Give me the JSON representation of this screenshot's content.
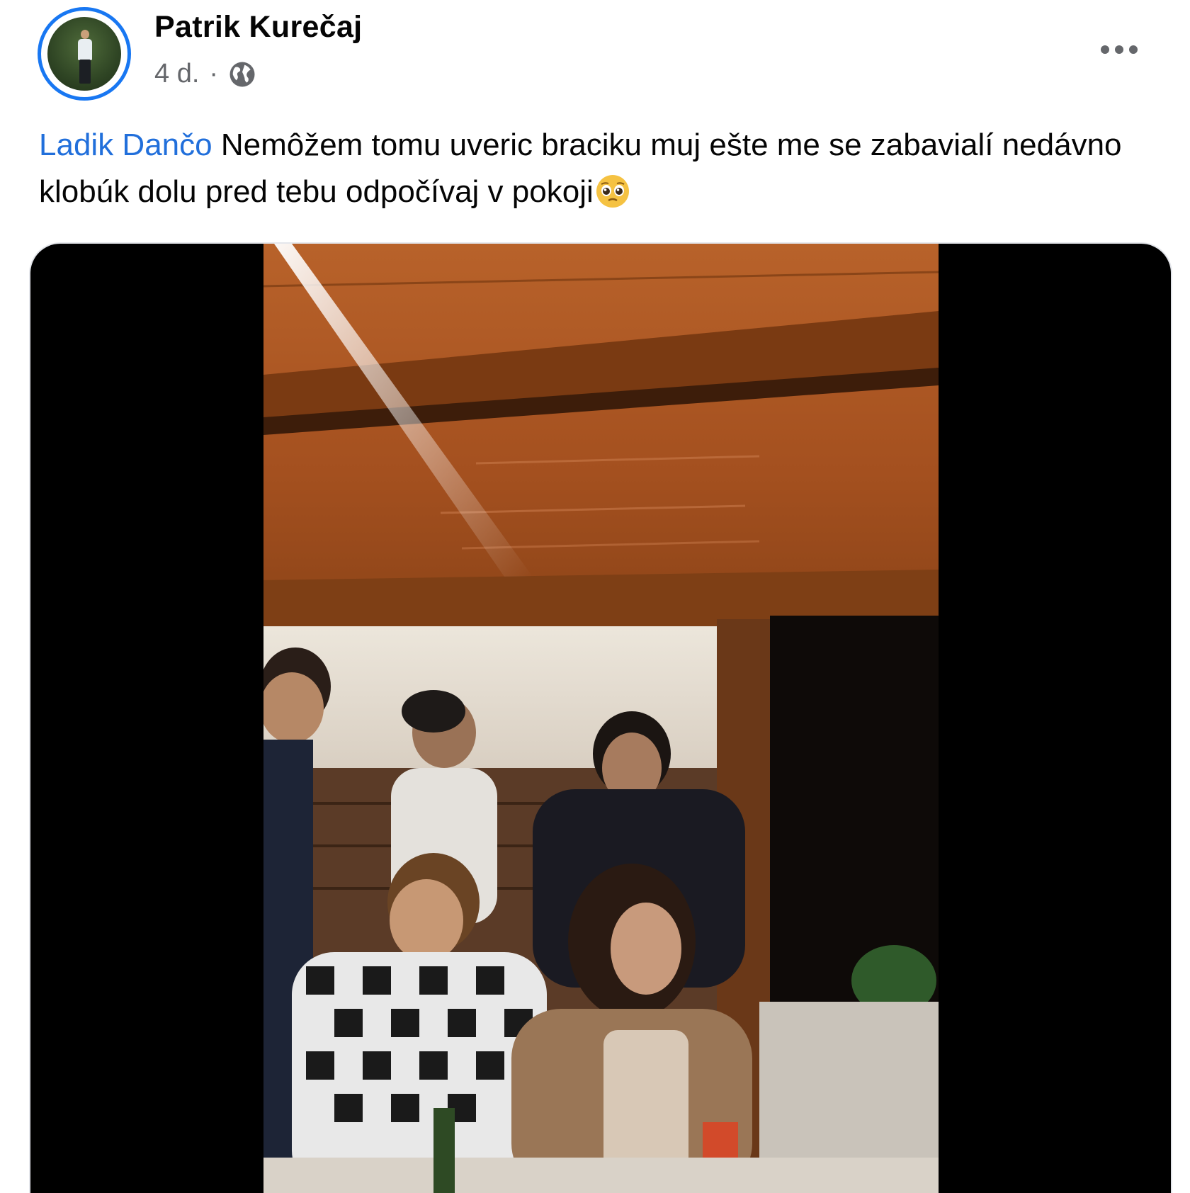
{
  "post": {
    "author": "Patrik Kurečaj",
    "time": "4 d.",
    "separator": "·",
    "audience_icon": "globe-icon",
    "more_icon": "more-horizontal-icon",
    "mention": "Ladik Dančo",
    "text": " Nemôžem tomu uveric braciku muj ešte me se zabavialí nedávno klobúk dolu pred tebu odpočívaj v pokoji",
    "emoji_icon": "pleading-face-emoji",
    "media": "video-frame"
  },
  "colors": {
    "accent": "#1877f2",
    "mention": "#216fdb",
    "meta": "#65676b"
  }
}
